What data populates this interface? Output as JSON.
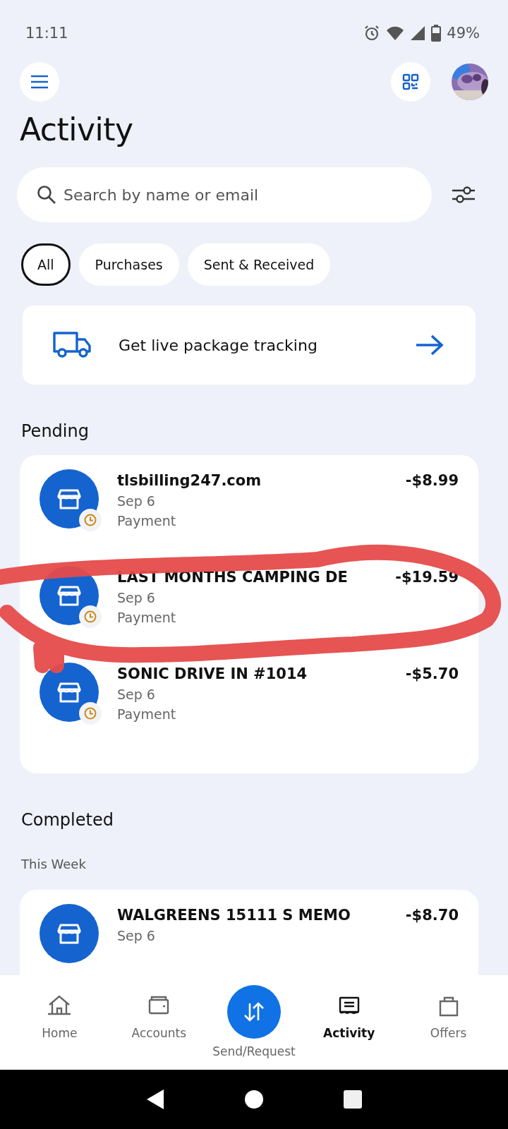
{
  "status_bar": {
    "time": "11:11",
    "battery": "49%"
  },
  "header": {
    "title": "Activity"
  },
  "search": {
    "placeholder": "Search by name or email"
  },
  "filters": [
    {
      "label": "All",
      "selected": true
    },
    {
      "label": "Purchases",
      "selected": false
    },
    {
      "label": "Sent & Received",
      "selected": false
    }
  ],
  "banner": {
    "text": "Get live package tracking"
  },
  "sections": [
    {
      "title": "Pending",
      "groups": [
        {
          "rows": [
            {
              "name": "tlsbilling247.com",
              "date": "Sep 6",
              "type": "Payment",
              "amount": "-$8.99",
              "pending": true
            },
            {
              "name": "LAST MONTHS CAMPING DE",
              "date": "Sep 6",
              "type": "Payment",
              "amount": "-$19.59",
              "pending": true
            },
            {
              "name": "SONIC DRIVE IN #1014",
              "date": "Sep 6",
              "type": "Payment",
              "amount": "-$5.70",
              "pending": true
            }
          ]
        }
      ]
    },
    {
      "title": "Completed",
      "groups": [
        {
          "label": "This Week",
          "rows": [
            {
              "name": "WALGREENS 15111 S MEMO",
              "date": "Sep 6",
              "amount": "-$8.70",
              "pending": false
            }
          ]
        }
      ]
    }
  ],
  "bottom_nav": [
    {
      "label": "Home",
      "kind": "tab",
      "selected": false
    },
    {
      "label": "Accounts",
      "kind": "tab",
      "selected": false
    },
    {
      "label": "Send/Request",
      "kind": "fab",
      "selected": false
    },
    {
      "label": "Activity",
      "kind": "tab",
      "selected": true
    },
    {
      "label": "Offers",
      "kind": "tab",
      "selected": false
    }
  ]
}
